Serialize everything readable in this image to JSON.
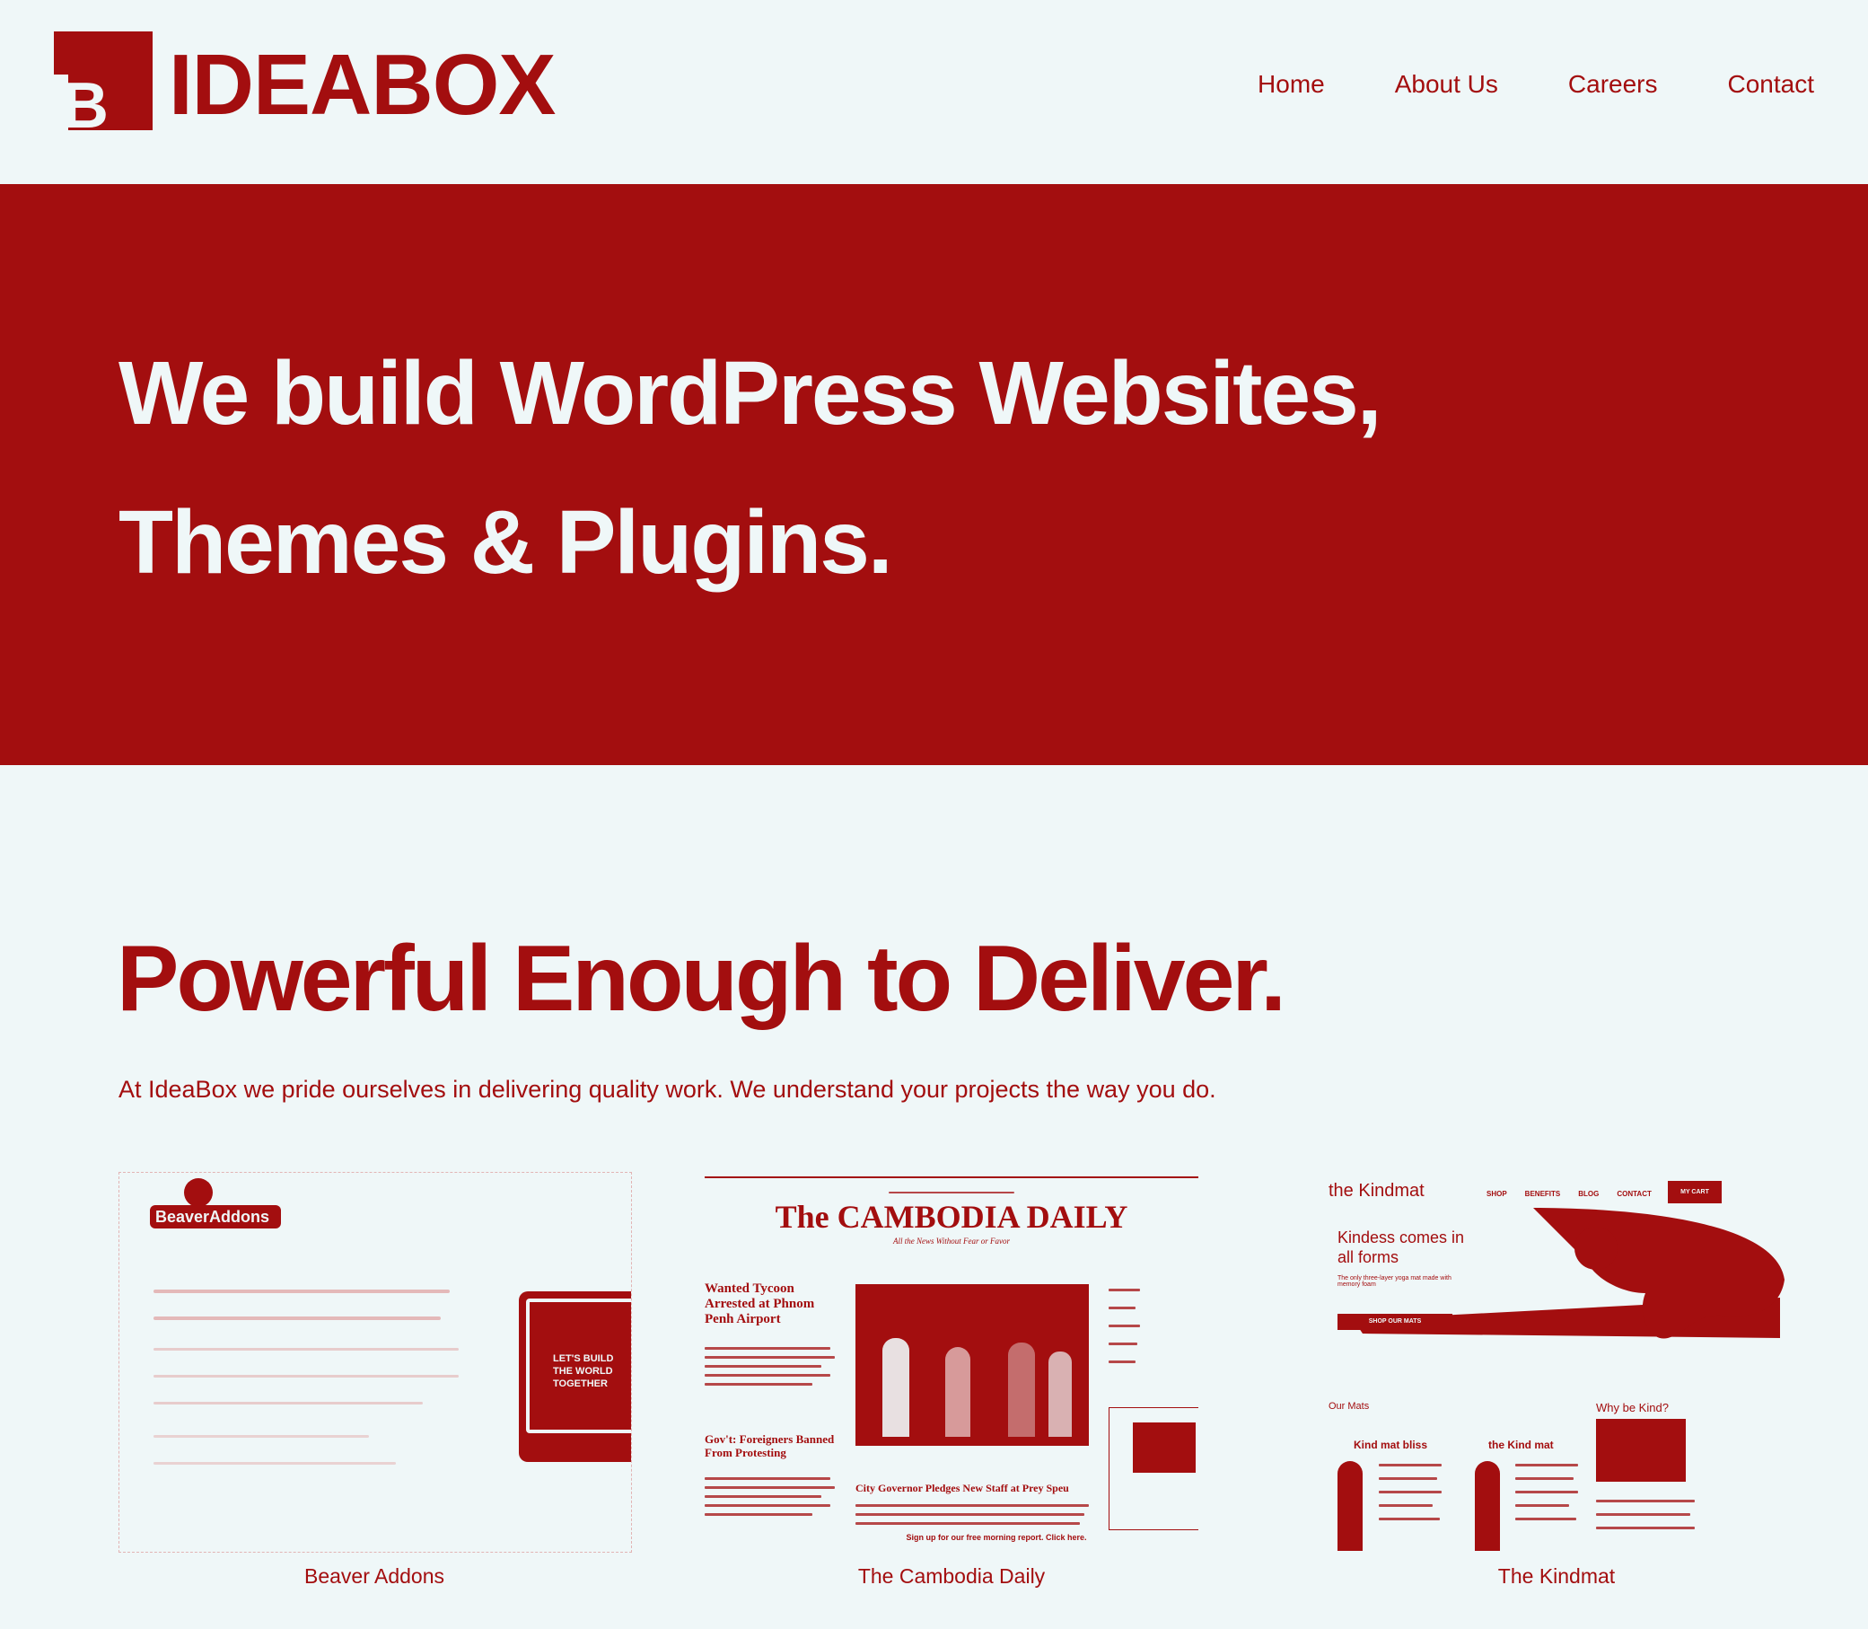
{
  "brand": {
    "logo_letter": "B",
    "name": "IDEABOX"
  },
  "nav": {
    "items": [
      {
        "label": "Home"
      },
      {
        "label": "About Us"
      },
      {
        "label": "Careers"
      },
      {
        "label": "Contact"
      }
    ]
  },
  "hero": {
    "line1": "We build WordPress Websites,",
    "line2": "Themes & Plugins."
  },
  "section": {
    "title": "Powerful Enough to Deliver.",
    "subtitle": "At IdeaBox we pride ourselves in delivering quality work. We understand your projects the way you do."
  },
  "portfolio": [
    {
      "caption": "Beaver Addons",
      "logo_text": "BeaverAddons",
      "device_text_1": "LET'S BUILD",
      "device_text_2": "THE WORLD",
      "device_text_3": "TOGETHER"
    },
    {
      "caption": "The Cambodia Daily",
      "masthead": "The CAMBODIA DAILY",
      "tagline": "All the News Without Fear or Favor",
      "headline_1": "Wanted Tycoon Arrested at Phnom Penh Airport",
      "headline_2": "Gov't: Foreigners Banned From Protesting",
      "headline_3": "City Governor Pledges New Staff at Prey Speu",
      "footer_cta": "Sign up for our free morning report. Click here."
    },
    {
      "caption": "The Kindmat",
      "logo_text": "the Kindmat",
      "menu": [
        "SHOP",
        "BENEFITS",
        "BLOG",
        "CONTACT"
      ],
      "cart_label": "MY CART",
      "hero_text": "Kindess comes in all forms",
      "hero_small": "The only three-layer yoga mat made with memory foam",
      "hero_button": "SHOP OUR MATS",
      "col1_title": "Our Mats",
      "col2_title": "Why be Kind?",
      "card1_title": "Kind mat bliss",
      "card2_title": "the Kind mat"
    }
  ],
  "colors": {
    "brand_red": "#a30e0f",
    "background": "#eff7f8"
  }
}
